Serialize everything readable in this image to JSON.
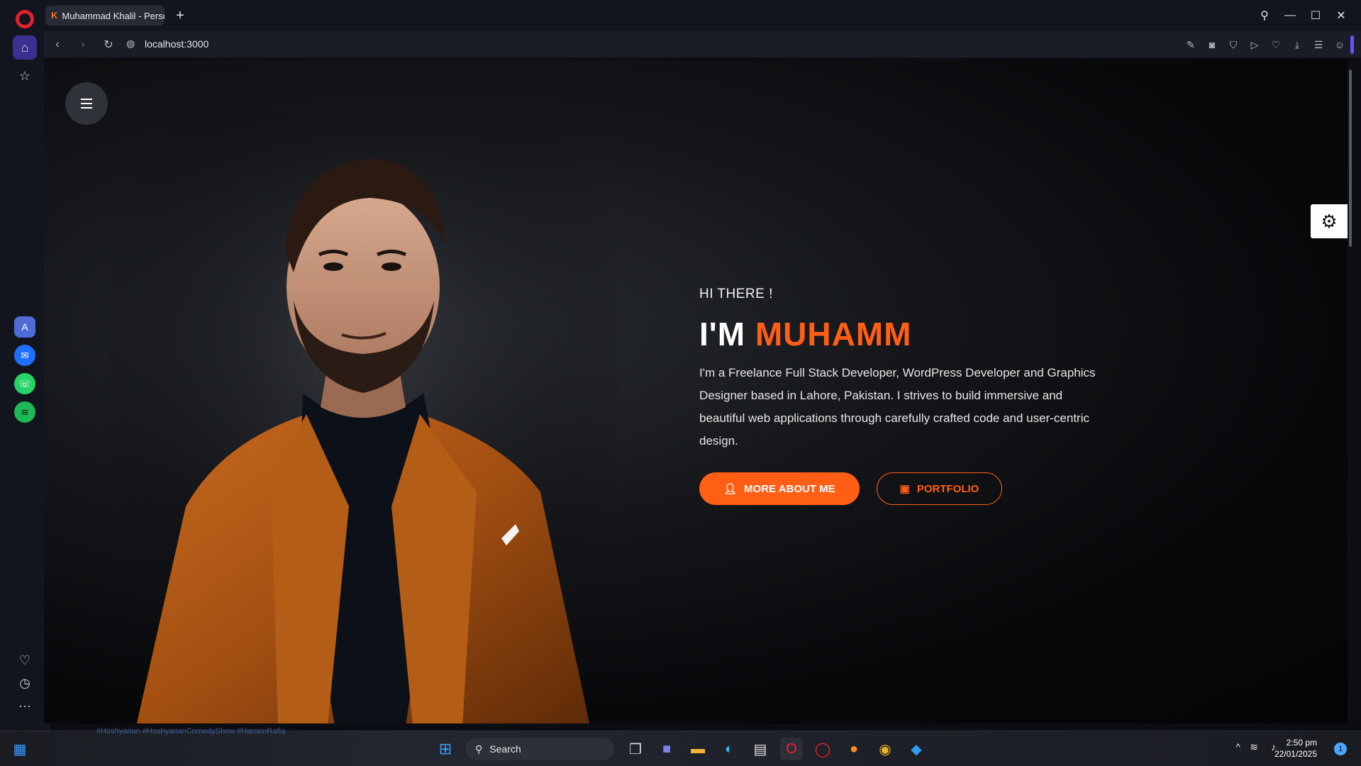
{
  "browser": {
    "tab_title": "Muhammad Khalil - Personal",
    "url": "localhost:3000"
  },
  "hero": {
    "greeting": "HI THERE !",
    "title_prefix": "I'M",
    "title_name": "MUHAMM",
    "description": "I'm a Freelance Full Stack Developer, WordPress Developer and Graphics Designer based in Lahore, Pakistan. I strives to build immersive and beautiful web applications through carefully crafted code and user-centric design.",
    "primary_button": "MORE ABOUT ME",
    "secondary_button": "PORTFOLIO"
  },
  "taskbar": {
    "ticker": "#Hoshyarian #HoshyarianComedyShow #HaroonRafiq",
    "search_label": "Search",
    "time": "2:50 pm",
    "date": "22/01/2025",
    "notifications": "1"
  },
  "colors": {
    "accent": "#ff5e14",
    "opera_red": "#e0222b",
    "active_sidebar": "#3b2f8f"
  }
}
